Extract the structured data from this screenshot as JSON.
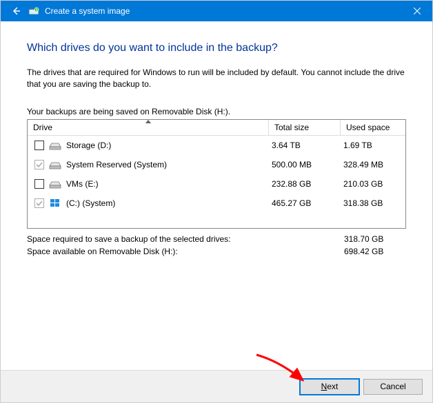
{
  "titlebar": {
    "title": "Create a system image"
  },
  "page": {
    "heading": "Which drives do you want to include in the backup?",
    "description": "The drives that are required for Windows to run will be included by default. You cannot include the drive that you are saving the backup to.",
    "saved_to": "Your backups are being saved on Removable Disk (H:)."
  },
  "table": {
    "headers": {
      "drive": "Drive",
      "total": "Total size",
      "used": "Used space"
    },
    "rows": [
      {
        "checked": false,
        "disabled": false,
        "icon": "drive",
        "label": "Storage (D:)",
        "total": "3.64 TB",
        "used": "1.69 TB"
      },
      {
        "checked": true,
        "disabled": true,
        "icon": "drive",
        "label": "System Reserved (System)",
        "total": "500.00 MB",
        "used": "328.49 MB"
      },
      {
        "checked": false,
        "disabled": false,
        "icon": "drive",
        "label": "VMs (E:)",
        "total": "232.88 GB",
        "used": "210.03 GB"
      },
      {
        "checked": true,
        "disabled": true,
        "icon": "win",
        "label": "(C:) (System)",
        "total": "465.27 GB",
        "used": "318.38 GB"
      }
    ]
  },
  "summary": {
    "required_label": "Space required to save a backup of the selected drives:",
    "required_value": "318.70 GB",
    "available_label": "Space available on Removable Disk (H:):",
    "available_value": "698.42 GB"
  },
  "buttons": {
    "next": "Next",
    "cancel": "Cancel"
  }
}
